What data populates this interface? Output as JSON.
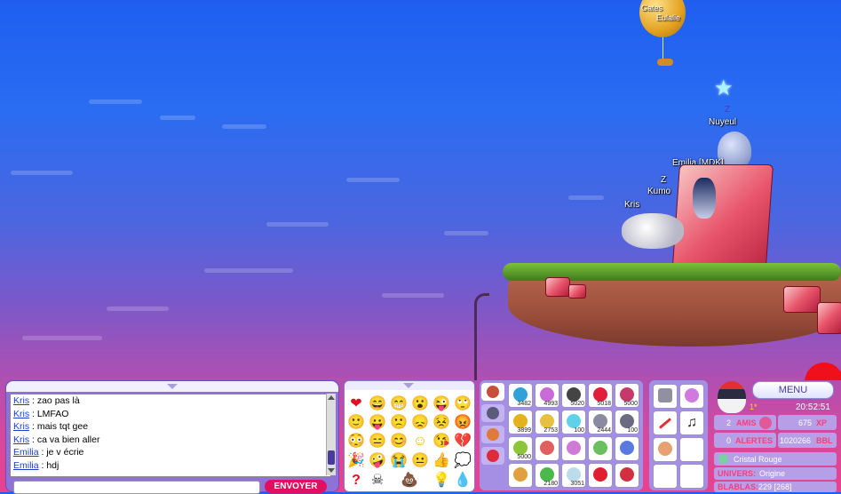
{
  "scene": {
    "balloon_names": [
      "Gates",
      "Eulalie"
    ],
    "players": [
      {
        "name": "Nuyeul"
      },
      {
        "name": "Emilia [MDK]"
      },
      {
        "name": "Kumo"
      },
      {
        "name": "Kris"
      }
    ],
    "sleep_marks": [
      "Z",
      "Z"
    ]
  },
  "chat": {
    "messages": [
      {
        "nick": "Kris",
        "text": " : zao pas là"
      },
      {
        "nick": "Kris",
        "text": " : LMFAO"
      },
      {
        "nick": "Kris",
        "text": " : mais tqt gee"
      },
      {
        "nick": "Kris",
        "text": " : ca va bien aller"
      },
      {
        "nick": "Emilia",
        "text": " : je v écrie"
      },
      {
        "nick": "Emilia",
        "text": " : hdj"
      }
    ],
    "input_value": "",
    "send_label": "ENVOYER"
  },
  "emotes": [
    "heart",
    "laugh",
    "grin",
    "surprised",
    "wink",
    "eye-roll",
    "smile",
    "tongue",
    "sad",
    "frown",
    "annoyed",
    "angry",
    "blush",
    "bored",
    "happy",
    "content",
    "kiss",
    "broken-heart",
    "party",
    "crazy",
    "cry",
    "neutral",
    "thumbs-up",
    "thought",
    "question",
    "skull",
    "poop",
    "idea",
    "drop"
  ],
  "inventory": {
    "items": [
      {
        "count": "3482",
        "color": "#2fa3d9"
      },
      {
        "count": "4993",
        "color": "#c86bd8"
      },
      {
        "count": "5020",
        "color": "#444444"
      },
      {
        "count": "5018",
        "color": "#e0203a"
      },
      {
        "count": "5000",
        "color": "#c53a6a"
      },
      {
        "count": "3899",
        "color": "#e3b21d"
      },
      {
        "count": "2753",
        "color": "#e8c040"
      },
      {
        "count": "100",
        "color": "#5fd1e8"
      },
      {
        "count": "2444",
        "color": "#8a8aa0"
      },
      {
        "count": "100",
        "color": "#6a6a80"
      },
      {
        "count": "5000",
        "color": "#8cc43a"
      },
      {
        "count": "",
        "color": "#e06060"
      },
      {
        "count": "",
        "color": "#d07ad8"
      },
      {
        "count": "",
        "color": "#6ac060"
      },
      {
        "count": "",
        "color": "#5a7ae0"
      },
      {
        "count": "",
        "color": "#e0a040"
      },
      {
        "count": "2180",
        "color": "#4ab84a"
      },
      {
        "count": "3051",
        "color": "#bcdcec"
      },
      {
        "count": "",
        "color": "#e02030"
      },
      {
        "count": "",
        "color": "#d03040"
      }
    ]
  },
  "profile": {
    "menu_label": "MENU",
    "level": "1*",
    "time": "20:52:51",
    "friends_count": "2",
    "friends_label": "AMIS",
    "alerts_count": "0",
    "alerts_label": "ALERTES",
    "xp_value": "675",
    "xp_label": "XP",
    "bbl_value": "1020266",
    "bbl_label": "BBL",
    "clan": "Cristal Rouge",
    "universe_label": "UNIVERS:",
    "universe": "Origine",
    "blablas_label": "BLABLAS:",
    "blablas": "229 [268]"
  }
}
